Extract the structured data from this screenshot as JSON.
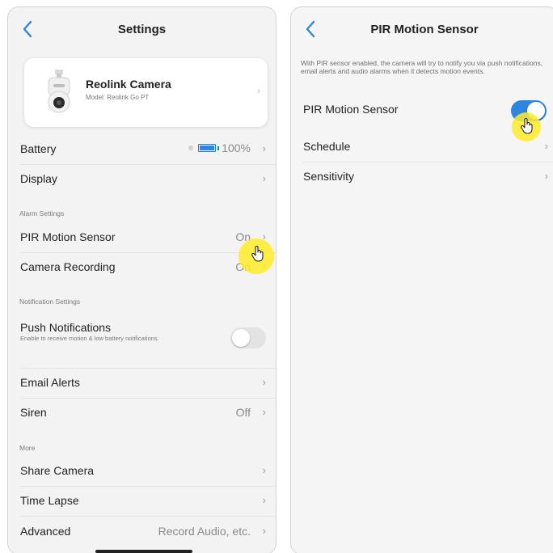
{
  "left": {
    "title": "Settings",
    "camera": {
      "name": "Reolink Camera",
      "model": "Model: Reolink Go PT",
      "chevron": "›"
    },
    "battery": {
      "label": "Battery",
      "value": "100%",
      "level_percent": 100
    },
    "display": {
      "label": "Display"
    },
    "alarm_section": "Alarm Settings",
    "pir": {
      "label": "PIR Motion Sensor",
      "value": "On"
    },
    "recording": {
      "label": "Camera Recording",
      "value": "On"
    },
    "notification_section": "Notification Settings",
    "push": {
      "label": "Push Notifications",
      "sub": "Enable to receive motion & low battery notifications.",
      "enabled": false
    },
    "email": {
      "label": "Email Alerts"
    },
    "siren": {
      "label": "Siren",
      "value": "Off"
    },
    "more_section": "More",
    "share": {
      "label": "Share Camera"
    },
    "timelapse": {
      "label": "Time Lapse"
    },
    "advanced": {
      "label": "Advanced",
      "value": "Record Audio, etc."
    },
    "chevron": "›"
  },
  "right": {
    "title": "PIR Motion Sensor",
    "description": "With PIR sensor enabled, the camera will try to notify you via push notifications, email alerts and audio alarms when it detects motion events.",
    "pir_toggle": {
      "label": "PIR Motion Sensor",
      "enabled": true
    },
    "schedule": {
      "label": "Schedule"
    },
    "sensitivity": {
      "label": "Sensitivity"
    },
    "chevron": "›"
  },
  "colors": {
    "accent": "#2f86e0",
    "highlight": "#ffeb28",
    "back_arrow": "#2f86e0"
  },
  "icons": {
    "back": "chevron-left-icon",
    "cursor": "hand-pointer-icon",
    "camera": "camera-product-icon"
  }
}
